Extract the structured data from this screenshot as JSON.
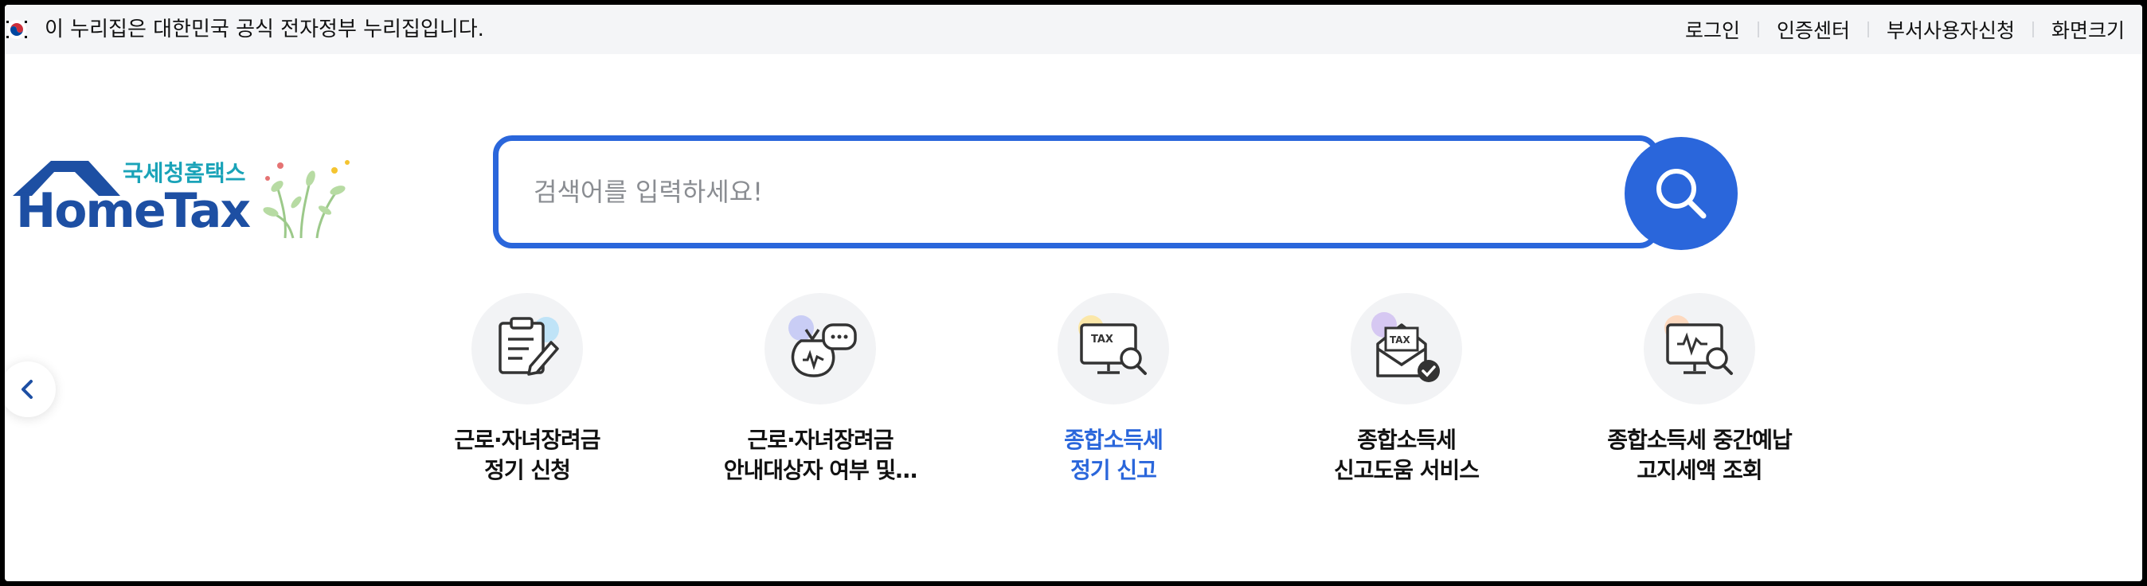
{
  "gov_bar": {
    "notice": "이 누리집은 대한민국 공식 전자정부 누리집입니다.",
    "links": [
      "로그인",
      "인증센터",
      "부서사용자신청",
      "화면크기"
    ]
  },
  "logo": {
    "subtitle": "국세청홈택스",
    "title": "HomeTax"
  },
  "search": {
    "placeholder": "검색어를 입력하세요!"
  },
  "quick_menu": [
    {
      "line1": "근로·자녀장려금",
      "line2": "정기 신청",
      "icon": "clipboard-pen-icon",
      "active": false
    },
    {
      "line1": "근로·자녀장려금",
      "line2": "안내대상자 여부 및…",
      "icon": "money-bag-chat-icon",
      "active": false
    },
    {
      "line1": "종합소득세",
      "line2": "정기 신고",
      "icon": "tax-monitor-search-icon",
      "active": true
    },
    {
      "line1": "종합소득세",
      "line2": "신고도움 서비스",
      "icon": "tax-envelope-check-icon",
      "active": false
    },
    {
      "line1": "종합소득세 중간예납",
      "line2": "고지세액 조회",
      "icon": "won-monitor-search-icon",
      "active": false
    }
  ],
  "colors": {
    "accent": "#2a66db",
    "logo_blue": "#1d4fa3",
    "logo_teal": "#1aa3b8"
  }
}
